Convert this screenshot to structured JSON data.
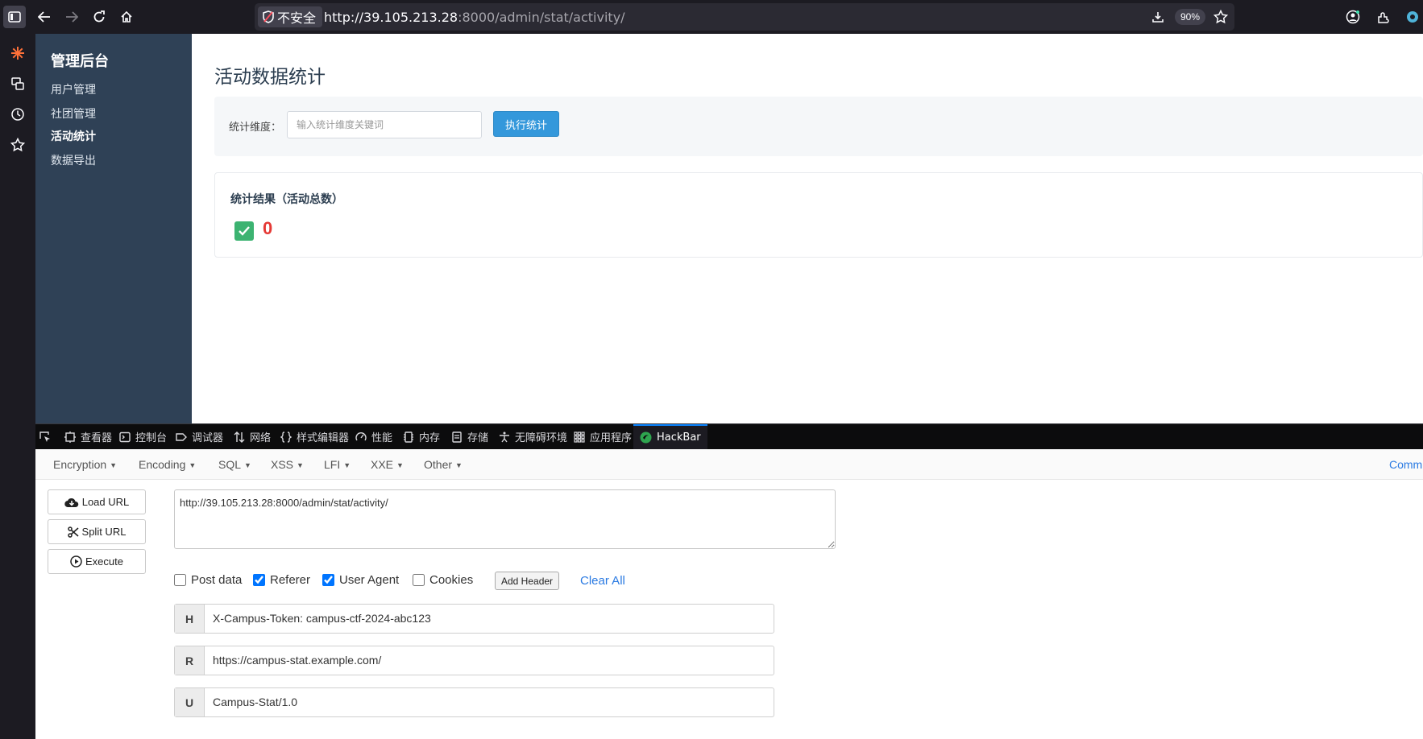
{
  "browser": {
    "security_label": "不安全",
    "url_host": "http://39.105.213.28",
    "url_rest": ":8000/admin/stat/activity/",
    "zoom": "90%"
  },
  "admin": {
    "title": "管理后台",
    "nav": [
      "用户管理",
      "社团管理",
      "活动统计",
      "数据导出"
    ],
    "active_nav": "活动统计"
  },
  "page": {
    "title": "活动数据统计",
    "filter_label": "统计维度：",
    "dimension_placeholder": "输入统计维度关键词",
    "run_button": "执行统计",
    "result_title": "统计结果（活动总数）",
    "result_value": "0"
  },
  "devtools": {
    "tabs": [
      "查看器",
      "控制台",
      "调试器",
      "网络",
      "样式编辑器",
      "性能",
      "内存",
      "存储",
      "无障碍环境",
      "应用程序",
      "HackBar"
    ],
    "active_tab": "HackBar"
  },
  "hackbar": {
    "menu": [
      "Encryption",
      "Encoding",
      "SQL",
      "XSS",
      "LFI",
      "XXE",
      "Other"
    ],
    "commit_link": "Commi",
    "load_url": "Load URL",
    "split_url": "Split URL",
    "execute": "Execute",
    "url_value": "http://39.105.213.28:8000/admin/stat/activity/",
    "options": [
      {
        "label": "Post data",
        "checked": false
      },
      {
        "label": "Referer",
        "checked": true
      },
      {
        "label": "User Agent",
        "checked": true
      },
      {
        "label": "Cookies",
        "checked": false
      }
    ],
    "add_header": "Add Header",
    "clear_all": "Clear All",
    "headers": [
      {
        "tag": "H",
        "value": "X-Campus-Token: campus-ctf-2024-abc123"
      },
      {
        "tag": "R",
        "value": "https://campus-stat.example.com/"
      },
      {
        "tag": "U",
        "value": "Campus-Stat/1.0"
      }
    ]
  }
}
